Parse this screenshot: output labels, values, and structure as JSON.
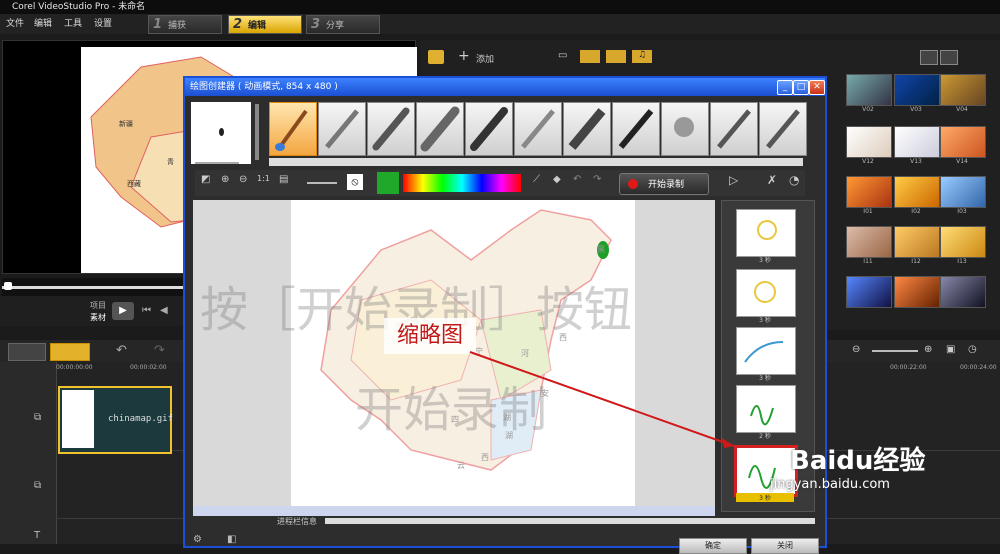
{
  "app": {
    "title": "Corel VideoStudio Pro - 未命名"
  },
  "menu": [
    "文件",
    "编辑",
    "工具",
    "设置"
  ],
  "steps": [
    {
      "num": "1",
      "label": "捕获"
    },
    {
      "num": "2",
      "label": "编辑"
    },
    {
      "num": "3",
      "label": "分享"
    }
  ],
  "preview": {
    "project_label": "项目",
    "clip_label": "素材",
    "map_labels": [
      "新疆",
      "青",
      "西藏"
    ]
  },
  "library": {
    "add_label": "添加",
    "thumb_labels": [
      "V02",
      "V03",
      "V04",
      "V12",
      "V13",
      "V14",
      "I01",
      "I02",
      "I03",
      "I11",
      "I12",
      "I13"
    ]
  },
  "timeline": {
    "timecodes": [
      "00:00:00:00",
      "00:00:02:00",
      "00:00:22:00",
      "00:00:24:00"
    ],
    "clip_name": "chinamap.gif"
  },
  "dialog": {
    "title": "绘图创建器 ( 动画模式, 854 x 480 )",
    "record_label": "开始录制",
    "progress_label": "进程栏信息",
    "ok_label": "确定",
    "close_label": "关闭",
    "thumb_labels": [
      "3 秒",
      "3 秒",
      "3 秒",
      "2 秒",
      "3 秒"
    ],
    "map_chars": [
      "黑",
      "西",
      "河",
      "宁",
      "安",
      "湖",
      "湖",
      "四",
      "云",
      "西"
    ]
  },
  "overlay": {
    "line1": "按［开始录制］按钮",
    "line2": "开始录制",
    "callout": "缩略图",
    "watermark_main": "Baidu经验",
    "watermark_sub": "jingyan.baidu.com"
  },
  "colors": {
    "accent": "#f2c12e",
    "dialog_border": "#1c4fd8",
    "record_red": "#e01818",
    "swatch_green": "#1fa82a"
  }
}
